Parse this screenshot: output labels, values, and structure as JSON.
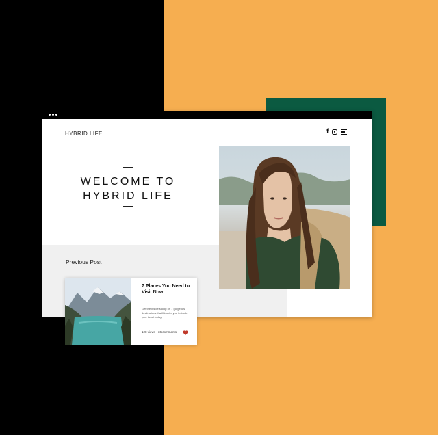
{
  "site": {
    "title": "HYBRID LIFE",
    "hero_line1": "WELCOME TO",
    "hero_line2": "HYBRID LIFE",
    "social_icons": [
      "facebook-icon",
      "instagram-icon",
      "menu-icon"
    ]
  },
  "nav": {
    "previous_post": "Previous Post →"
  },
  "card": {
    "title": "7 Places You Need to Visit Now",
    "description": "Get the inside scoop on 7 gorgeous destinations that'll inspire you to book your ticket today.",
    "views": "128 views",
    "comments": "36 comments",
    "heart_color": "#C0392B"
  },
  "colors": {
    "left_background": "#000000",
    "right_background": "#F6AE50",
    "accent_green": "#0B5A41"
  }
}
